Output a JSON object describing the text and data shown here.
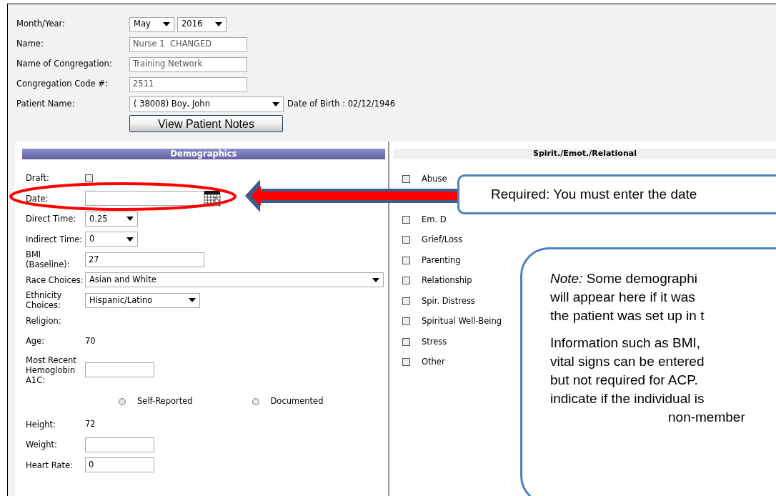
{
  "header": {
    "fields": [
      {
        "label": "Month/Year:",
        "kind": "month_year",
        "values": [
          "May",
          "2016"
        ]
      },
      {
        "label": "Name:",
        "kind": "text",
        "value": "Nurse 1  CHANGED"
      },
      {
        "label": "Name of Congregation:",
        "kind": "text",
        "value": "Training Network"
      },
      {
        "label": "Congregation Code #:",
        "kind": "text",
        "value": "2511"
      },
      {
        "label": "Patient Name:",
        "kind": "patient",
        "value": "( 38008) Boy, John",
        "note": "Date of Birth : 02/12/1946"
      }
    ],
    "button": "View Patient Notes"
  },
  "demographics": {
    "title": "Demographics",
    "rows": [
      {
        "label": "Draft:",
        "kind": "checkbox",
        "checked": false
      },
      {
        "label": "Date:",
        "kind": "date"
      },
      {
        "label": "Direct Time:",
        "kind": "select",
        "value": "0.25"
      },
      {
        "label": "Indirect Time:",
        "kind": "select",
        "value": "0"
      },
      {
        "label": "BMI (Baseline):",
        "kind": "text",
        "value": "27"
      },
      {
        "label": "Race Choices:",
        "kind": "select_wide",
        "value": "Asian and White"
      },
      {
        "label": "Ethnicity Choices:",
        "kind": "select_mid",
        "value": "Hispanic/Latino"
      },
      {
        "label": "Religion:",
        "kind": "static"
      },
      {
        "label": "Age:",
        "kind": "static",
        "value": "70"
      },
      {
        "label": "Most Recent Hemoglobin A1C:",
        "kind": "text_short"
      },
      {
        "kind": "radios",
        "options": [
          {
            "label": "Self-Reported",
            "selected": false
          },
          {
            "label": "Documented",
            "selected": false
          }
        ]
      },
      {
        "label": "Height:",
        "kind": "static",
        "value": "72"
      },
      {
        "label": "Weight:",
        "kind": "text_short"
      },
      {
        "label": "Heart Rate:",
        "kind": "text_short",
        "value": "0"
      }
    ]
  },
  "spiritual": {
    "title": "Spirit./Emot./Relational",
    "items": [
      {
        "label": "Abuse",
        "checked": false
      },
      {
        "label": "Em. D",
        "checked": false
      },
      {
        "label": "Grief/Loss",
        "checked": false
      },
      {
        "label": "Parenting",
        "checked": false
      },
      {
        "label": "Relationship",
        "checked": false
      },
      {
        "label": "Spir. Distress",
        "checked": false
      },
      {
        "label": "Spiritual Well-Being",
        "checked": false
      },
      {
        "label": "Stress",
        "checked": false
      },
      {
        "label": "Other",
        "checked": false
      }
    ]
  },
  "callouts": {
    "required": "Required: You must enter the date",
    "note_paragraphs": [
      [
        "*Note:*  Some demographi",
        "will appear here if it was",
        "the patient was set up in t"
      ],
      [
        "Information such as BMI,",
        "vital signs can be entered",
        "but not required for ACP.",
        "indicate if the individual is",
        "non-member"
      ]
    ]
  }
}
